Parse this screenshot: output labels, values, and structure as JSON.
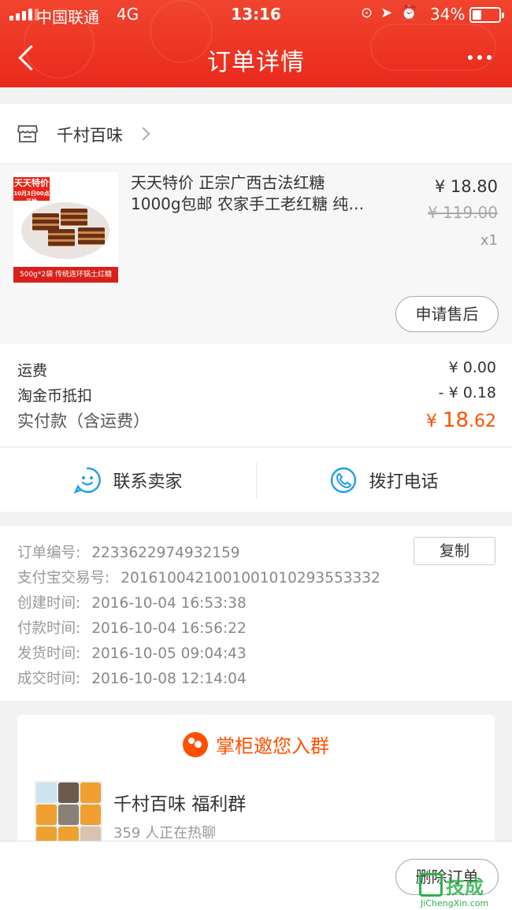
{
  "status_bar": {
    "carrier": "中国联通",
    "network": "4G",
    "time": "13:16",
    "battery_percent": "34%",
    "battery_level": 0.34
  },
  "nav": {
    "title": "订单详情"
  },
  "shop": {
    "name": "千村百味"
  },
  "product": {
    "title_line1": "天天特价 正宗广西古法红糖",
    "title_line2": "1000g包邮 农家手工老红糖 纯…",
    "price": "¥ 18.80",
    "original_price": "¥ 119.00",
    "quantity": "x1",
    "after_sale_label": "申请售后",
    "thumb_badge": "天天特价",
    "thumb_badge_sub": "10月3日00点开抢",
    "thumb_banner": "500g*2袋 传统连环锅土红糖"
  },
  "fees": {
    "shipping_label": "运费",
    "shipping_value": "¥ 0.00",
    "coin_label": "淘金币抵扣",
    "coin_value": "- ¥ 0.18",
    "total_label": "实付款（含运费）",
    "total_currency": "¥",
    "total_int": "18",
    "total_dec": ".62",
    "accent_color": "#ff5000"
  },
  "contact": {
    "seller_label": "联系卖家",
    "phone_label": "拨打电话",
    "icon_color": "#1e9fe6"
  },
  "order_info": {
    "order_no_label": "订单编号:",
    "order_no": "2233622974932159",
    "copy_label": "复制",
    "alipay_label": "支付宝交易号:",
    "alipay_no": "2016100421001001010293553332",
    "created_label": "创建时间:",
    "created": "2016-10-04 16:53:38",
    "paid_label": "付款时间:",
    "paid": "2016-10-04 16:56:22",
    "shipped_label": "发货时间:",
    "shipped": "2016-10-05 09:04:43",
    "closed_label": "成交时间:",
    "closed": "2016-10-08 12:14:04"
  },
  "group": {
    "heading": "掌柜邀您入群",
    "name": "千村百味 福利群",
    "members": "359 人正在热聊"
  },
  "bottom": {
    "delete_label": "删除订单"
  },
  "watermark": {
    "logo_text": "技成",
    "url": "JiChengXin.com"
  }
}
